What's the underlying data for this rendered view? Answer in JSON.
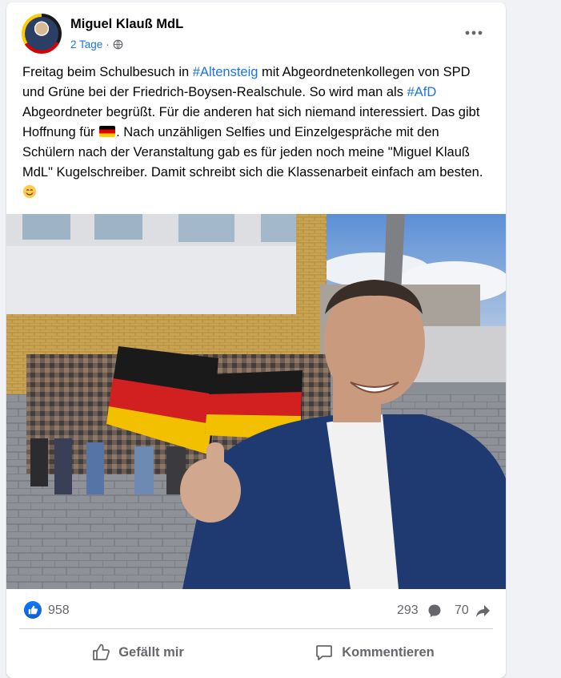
{
  "post": {
    "author": "Miguel Klauß MdL",
    "time": "2 Tage",
    "separator": "·",
    "privacy_icon": "globe-icon",
    "more_icon": "more-dots-icon",
    "text": {
      "p1": "Freitag beim Schulbesuch in ",
      "hashtag1": "#Altensteig",
      "p2": " mit Abgeordnetenkollegen von SPD und Grüne bei der Friedrich-Boysen-Realschule. So wird man als ",
      "hashtag2": "#AfD",
      "p3": " Abgeordneter begrüßt. Für die anderen hat sich niemand interessiert. Das gibt Hoffnung für ",
      "p4": ". Nach unzähligen Selfies und Einzelgespräche mit den Schülern nach der Veranstaltung gab es für jeden noch meine \"Miguel Klauß MdL\" Kugelschreiber. Damit schreibt sich die Klassenarbeit einfach am besten."
    }
  },
  "stats": {
    "likes": "958",
    "comments": "293",
    "shares": "70"
  },
  "actions": {
    "like_label": "Gefällt mir",
    "comment_label": "Kommentieren"
  },
  "colors": {
    "link": "#1b74e4",
    "muted": "#65676b",
    "like_blue": "#1877f2",
    "flag_black": "#000000",
    "flag_red": "#dd0000",
    "flag_gold": "#ffce00"
  }
}
